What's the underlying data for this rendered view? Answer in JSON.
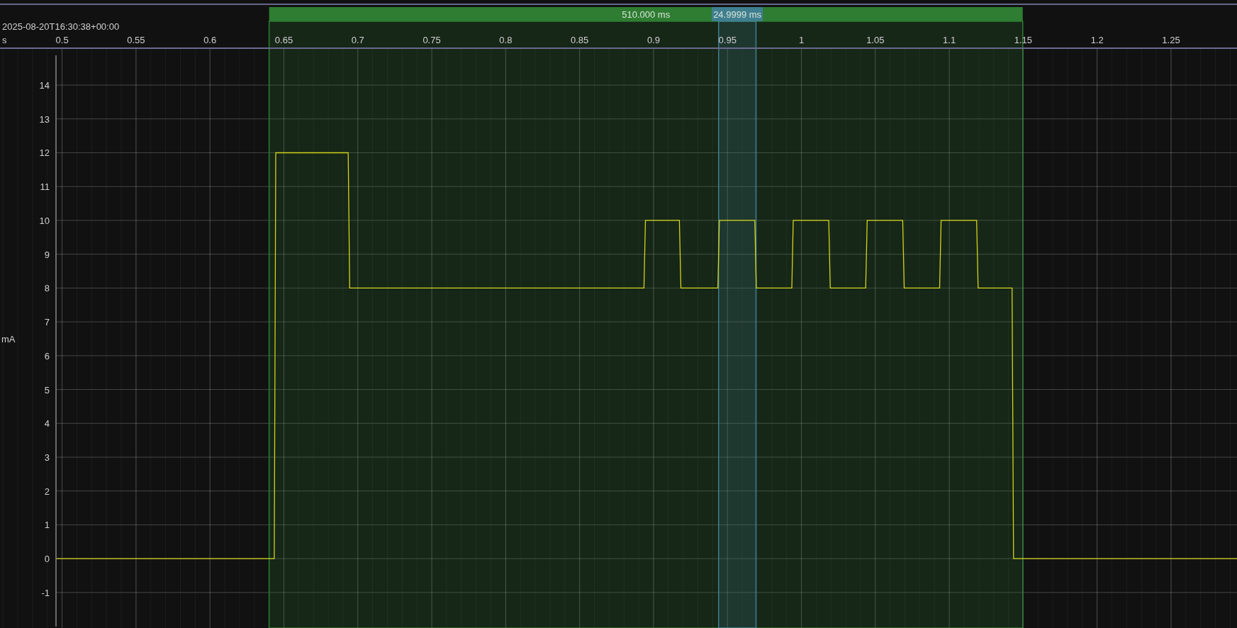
{
  "timestamp": "2025-08-20T16:30:38+00:00",
  "chart_data": {
    "type": "line",
    "xlabel": "s",
    "ylabel": "mA",
    "grid": true,
    "x": [
      0.4959,
      0.6435,
      0.6445,
      0.6935,
      0.6945,
      0.8935,
      0.8945,
      0.9175,
      0.9185,
      0.9435,
      0.9445,
      0.9685,
      0.9695,
      0.9935,
      0.9945,
      1.0185,
      1.0195,
      1.0435,
      1.0445,
      1.0685,
      1.0695,
      1.0935,
      1.0945,
      1.1185,
      1.1195,
      1.1425,
      1.1435,
      1.2946
    ],
    "series": [
      {
        "color": "#d4d41a",
        "values": [
          0,
          0,
          12,
          12,
          8,
          8,
          10,
          10,
          8,
          8,
          10,
          10,
          8,
          8,
          10,
          10,
          8,
          8,
          10,
          10,
          8,
          8,
          10,
          10,
          8,
          8,
          0,
          0
        ]
      }
    ],
    "xlim": [
      0.458,
      1.2946
    ],
    "ylim": [
      -2.05,
      15.09
    ],
    "xticks": [
      0.5,
      0.55,
      0.6,
      0.65,
      0.7,
      0.75,
      0.8,
      0.85,
      0.9,
      0.95,
      1,
      1.05,
      1.1,
      1.15,
      1.2,
      1.25
    ],
    "yticks": [
      -1,
      0,
      1,
      2,
      3,
      4,
      5,
      6,
      7,
      8,
      9,
      10,
      11,
      12,
      13,
      14
    ],
    "bands": [
      {
        "axis": "x",
        "from": 0.64,
        "to": 1.1497,
        "label": "510.000 ms",
        "color": "#2e7d32"
      },
      {
        "axis": "x",
        "from": 0.944,
        "to": 0.9693,
        "label": "24.9999 ms",
        "color": "#3f7f8f"
      }
    ]
  }
}
